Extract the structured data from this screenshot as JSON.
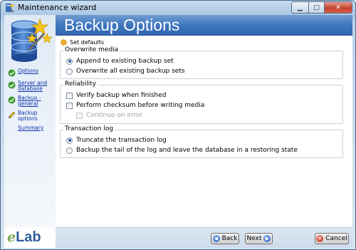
{
  "window": {
    "title": "Maintenance wizard",
    "icon": "wizard-app-icon"
  },
  "header": {
    "title": "Backup Options"
  },
  "sidebar": {
    "art": "database-stars-icon",
    "steps": [
      {
        "label": "Options",
        "status": "done",
        "icon": "green-check-icon"
      },
      {
        "label": "Server and database",
        "status": "done",
        "icon": "green-check-icon"
      },
      {
        "label": "Backup - general",
        "status": "done",
        "icon": "green-check-icon"
      },
      {
        "label": "Backup options",
        "status": "current",
        "icon": "pencil-icon"
      },
      {
        "label": "Summary",
        "status": "pending",
        "icon": ""
      }
    ],
    "logo": {
      "prefix": "e",
      "text": "Lab"
    }
  },
  "toolbar": {
    "set_defaults_label": "Set defaults",
    "set_defaults_icon": "sun-gear-icon"
  },
  "groups": {
    "overwrite": {
      "title": "Overwrite media",
      "options": [
        {
          "label": "Append to existing backup set",
          "checked": true
        },
        {
          "label": "Overwrite all existing backup sets",
          "checked": false
        }
      ]
    },
    "reliability": {
      "title": "Reliability",
      "options": [
        {
          "label": "Verify backup when finished",
          "checked": false
        },
        {
          "label": "Perform checksum before writing media",
          "checked": false
        },
        {
          "label": "Continue on error",
          "checked": false,
          "disabled": true
        }
      ]
    },
    "transaction": {
      "title": "Transaction log",
      "options": [
        {
          "label": "Truncate the transaction log",
          "checked": true
        },
        {
          "label": "Backup the tail of the log and leave the database in a restoring state",
          "checked": false
        }
      ]
    }
  },
  "footer": {
    "back_label": "Back",
    "next_label": "Next",
    "cancel_label": "Cancel"
  },
  "colors": {
    "header_blue": "#3d74bc",
    "link_blue": "#0b32a8",
    "check_green": "#3a9a2c"
  }
}
